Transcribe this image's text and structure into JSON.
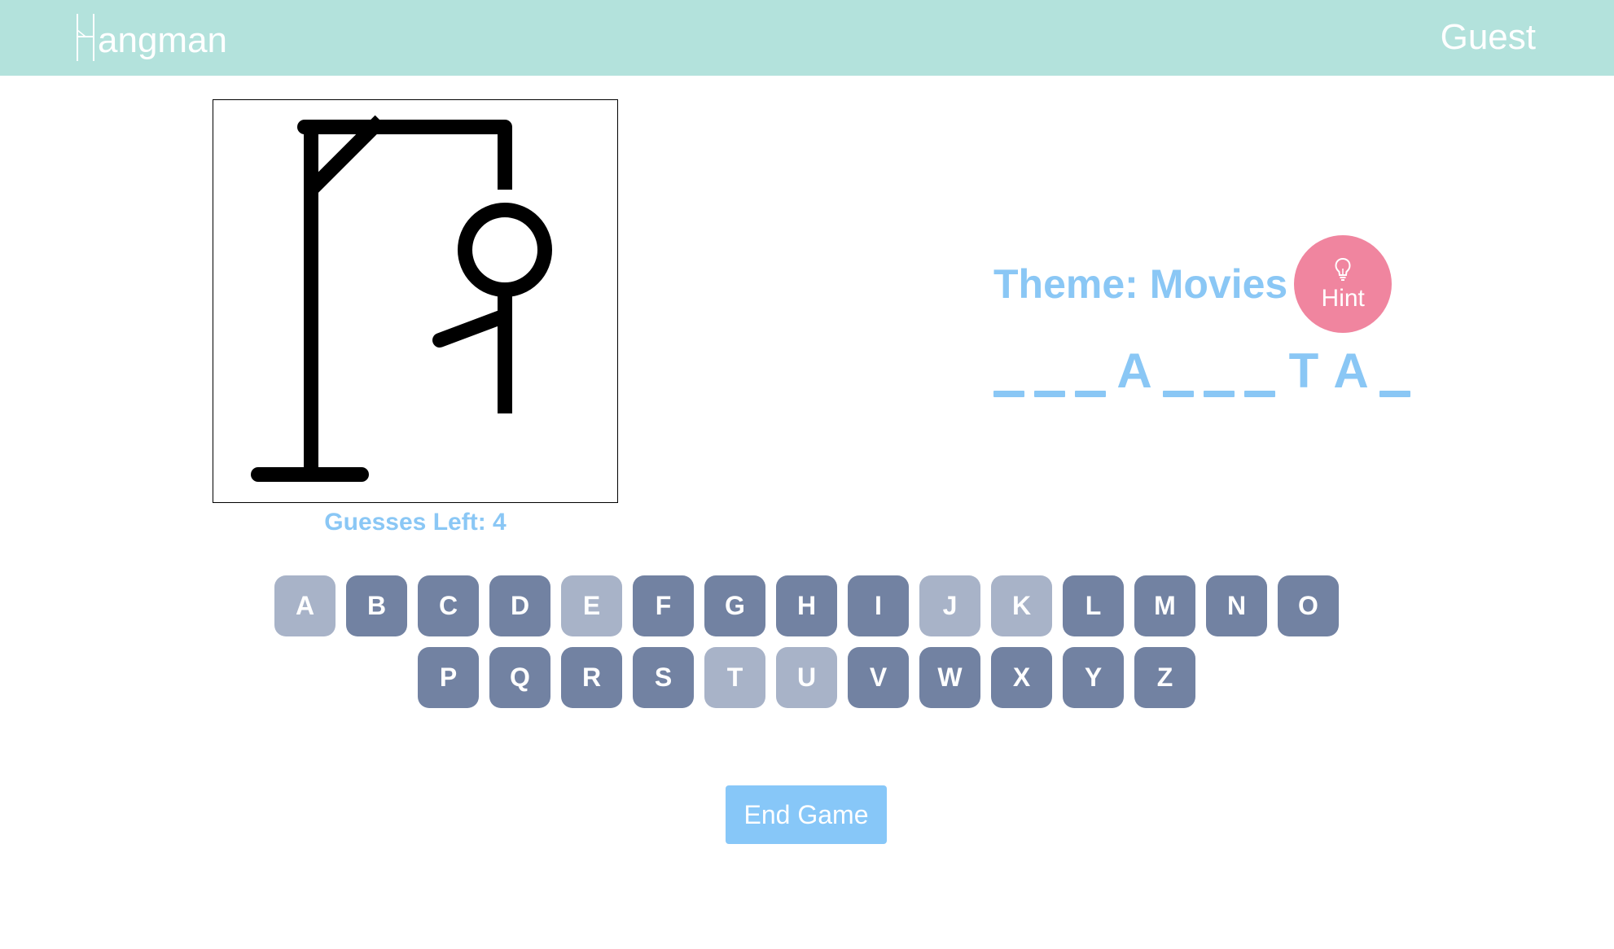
{
  "header": {
    "logo_text": "angman",
    "logo_icon": "gallows-h-logo-icon",
    "user_name": "Guest"
  },
  "game": {
    "guesses_left_text": "Guesses Left: 4",
    "theme_text": "Theme: Movies",
    "hint_label": "Hint",
    "hint_icon": "lightbulb-icon",
    "word": [
      "_",
      "_",
      "_",
      "A",
      "_",
      "_",
      "_",
      "T",
      "A",
      "_"
    ],
    "end_game_label": "End Game"
  },
  "keyboard": {
    "row1": [
      {
        "letter": "A",
        "used": true
      },
      {
        "letter": "B",
        "used": false
      },
      {
        "letter": "C",
        "used": false
      },
      {
        "letter": "D",
        "used": false
      },
      {
        "letter": "E",
        "used": true
      },
      {
        "letter": "F",
        "used": false
      },
      {
        "letter": "G",
        "used": false
      },
      {
        "letter": "H",
        "used": false
      },
      {
        "letter": "I",
        "used": false
      },
      {
        "letter": "J",
        "used": true
      },
      {
        "letter": "K",
        "used": true
      },
      {
        "letter": "L",
        "used": false
      },
      {
        "letter": "M",
        "used": false
      },
      {
        "letter": "N",
        "used": false
      },
      {
        "letter": "O",
        "used": false
      }
    ],
    "row2": [
      {
        "letter": "P",
        "used": false
      },
      {
        "letter": "Q",
        "used": false
      },
      {
        "letter": "R",
        "used": false
      },
      {
        "letter": "S",
        "used": false
      },
      {
        "letter": "T",
        "used": true
      },
      {
        "letter": "U",
        "used": true
      },
      {
        "letter": "V",
        "used": false
      },
      {
        "letter": "W",
        "used": false
      },
      {
        "letter": "X",
        "used": false
      },
      {
        "letter": "Y",
        "used": false
      },
      {
        "letter": "Z",
        "used": false
      }
    ]
  },
  "colors": {
    "header_bg": "#b3e2dc",
    "accent_blue": "#8ac7f5",
    "hint_pink": "#f0859f",
    "key_active": "#7282a2",
    "key_used": "#a8b3c8"
  }
}
